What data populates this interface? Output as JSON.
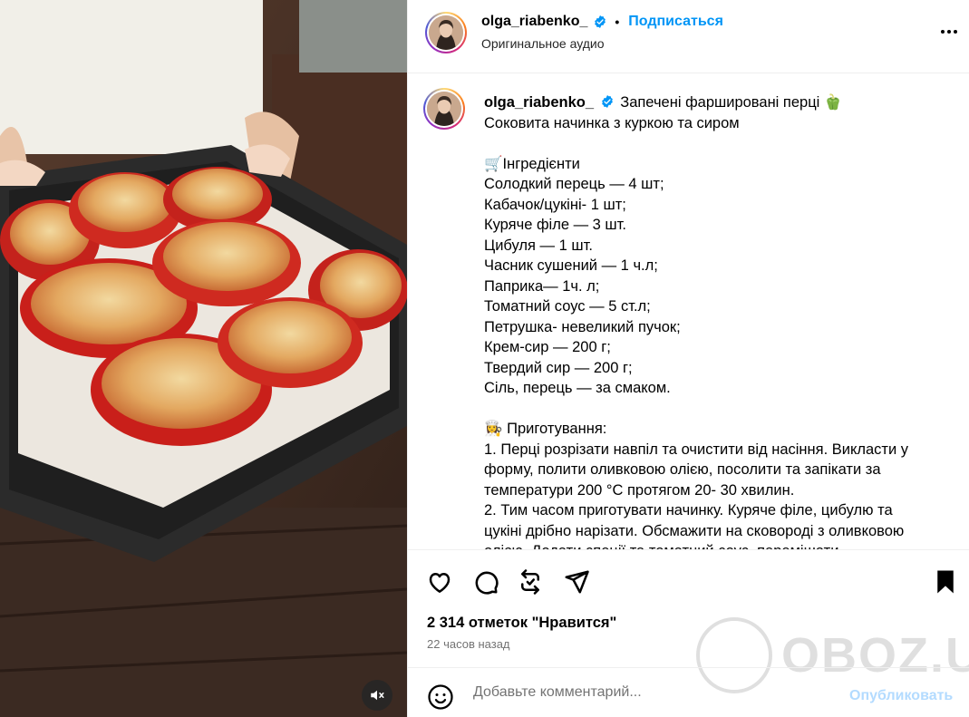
{
  "header": {
    "username": "olga_riabenko_",
    "follow_label": "Подписаться",
    "separator": "•",
    "audio": "Оригинальное аудио"
  },
  "caption": {
    "username": "olga_riabenko_",
    "lines": [
      "Запечені фаршировані перці 🫑",
      "Соковита начинка з куркою та сиром",
      "",
      "🛒Інгредієнти",
      "Солодкий перець — 4 шт;",
      "Кабачок/цукіні- 1 шт;",
      "Куряче філе — 3 шт.",
      "Цибуля — 1 шт.",
      "Часник сушений — 1 ч.л;",
      "Паприка— 1ч. л;",
      "Томатний соус — 5 ст.л;",
      "Петрушка- невеликий пучок;",
      "Крем-сир — 200 г;",
      "Твердий сир — 200 г;",
      "Сіль, перець — за смаком.",
      "",
      "👩‍🍳 Приготування:",
      "1. Перці розрізати навпіл та очистити від насіння. Викласти у",
      "форму, полити оливковою олією, посолити та запікати за",
      "температури 200 °С протягом 20- 30 хвилин.",
      "2. Тим часом приготувати начинку. Куряче філе, цибулю та",
      "цукіні дрібно нарізати. Обсмажити на сковороді з оливковою",
      "олією. Додати спеції та томатний соус, перемішати."
    ]
  },
  "stats": {
    "likes": "2 314 отметок \"Нравится\"",
    "time": "22 часов назад"
  },
  "comment": {
    "placeholder": "Добавьте комментарий...",
    "publish_label": "Опубликовать"
  },
  "watermark": "OBOZ.UA",
  "icons": {
    "like": "heart-icon",
    "comment": "comment-icon",
    "repost": "repost-icon",
    "share": "send-icon",
    "save": "bookmark-icon",
    "more": "more-icon",
    "emoji": "emoji-icon",
    "mute": "muted-speaker-icon",
    "verified": "verified-badge-icon"
  },
  "colors": {
    "accent": "#0095f6",
    "publish_disabled": "#b3dbff",
    "verified": "#0095f6",
    "muted_text": "#737373"
  }
}
